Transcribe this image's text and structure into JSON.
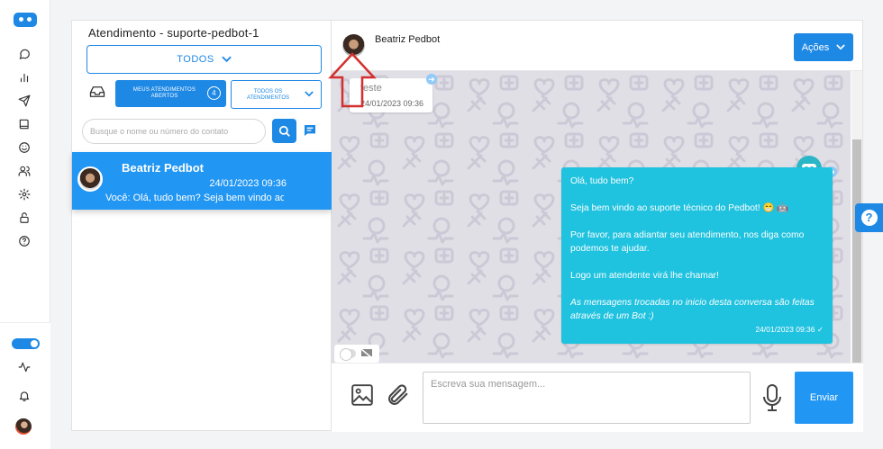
{
  "sidebar": {
    "icons": [
      "logo-icon",
      "chat-icon",
      "chart-icon",
      "send-icon",
      "book-icon",
      "smile-icon",
      "users-icon",
      "gear-icon",
      "lock-icon",
      "help-icon",
      "activity-icon",
      "bell-icon"
    ]
  },
  "list": {
    "title": "Atendimento - suporte-pedbot-1",
    "filter_label": "TODOS",
    "meus_label": "MEUS ATENDIMENTOS ABERTOS",
    "meus_count": "4",
    "todos_at_label": "TODOS OS ATENDIMENTOS",
    "search_placeholder": "Busque o nome ou número do contato",
    "conversations": [
      {
        "name": "Beatriz Pedbot",
        "time": "24/01/2023 09:36",
        "preview": "Você: Olá, tudo bem? Seja bem vindo ao suporte técnico do Pedbot!"
      }
    ]
  },
  "chat": {
    "contact_name": "Beatriz Pedbot",
    "actions_label": "Ações",
    "incoming": {
      "text": "teste",
      "time": "24/01/2023 09:36"
    },
    "outgoing": {
      "lines": [
        "Olá, tudo bem?",
        "Seja bem vindo ao suporte técnico do Pedbot! 😁 🤖",
        "Por favor, para adiantar seu atendimento, nos diga como podemos te ajudar.",
        "Logo um atendente virá lhe chamar!",
        "As mensagens trocadas no inicio desta conversa são feitas através de um Bot :)"
      ],
      "time": "24/01/2023 09:36"
    },
    "input_placeholder": "Escreva sua mensagem...",
    "send_label": "Enviar"
  },
  "colors": {
    "primary": "#1e88e5",
    "bot_bubble": "#1fc2df",
    "annotation": "#d32f2f"
  }
}
